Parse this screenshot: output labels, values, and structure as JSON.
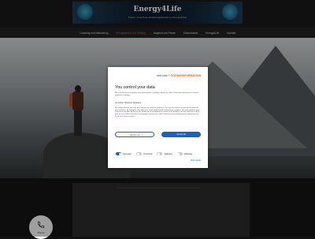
{
  "header": {
    "title": "Energy4Life",
    "subtitle": "Praxis • Coaching • Ernährungsberatung • Energiearbeit",
    "logo_left": "logo-icon",
    "logo_right": "logo-icon"
  },
  "nav": {
    "items": [
      {
        "label": "Coaching und Networking"
      },
      {
        "label": "Energiearbeit und Training",
        "active": true
      },
      {
        "label": "Angebot und Preise"
      },
      {
        "label": "Erkenntnisse"
      },
      {
        "label": "Energy4Life"
      },
      {
        "label": "Kontakt"
      }
    ]
  },
  "contact": {
    "phone_label": "Phone",
    "icon": "phone-icon"
  },
  "consent": {
    "brand_one": "one.com",
    "brand_sep": "+",
    "brand_cookie": "COOKIEINFORMATION",
    "title": "You control your data",
    "intro": "We and our business partners use technologies, including cookies, to collect information about you for various purposes, including:",
    "purposes": "Functional, Statistical, Marketing",
    "body": "By clicking 'Accept' you give your consent for all these purposes. You can also choose to specify the purposes you consent to by ticking the checkbox next to the purpose and clicking 'Save settings'. You may withdraw your consent at any time by clicking the small icon at the bottom left corner of the website. You can read more about how we use cookies and other technologies and how we collect and process personal data by clicking the link.",
    "read_more": "Read more about cookies",
    "deny_label": "Decline all",
    "accept_label": "Accept all",
    "toggles": [
      {
        "label": "Necessary",
        "on": true
      },
      {
        "label": "Functional",
        "on": false
      },
      {
        "label": "Statistical",
        "on": false
      },
      {
        "label": "Marketing",
        "on": false
      }
    ],
    "details_label": "Show details"
  },
  "colors": {
    "accent": "#e25b2a",
    "button_blue": "#1565c0"
  }
}
